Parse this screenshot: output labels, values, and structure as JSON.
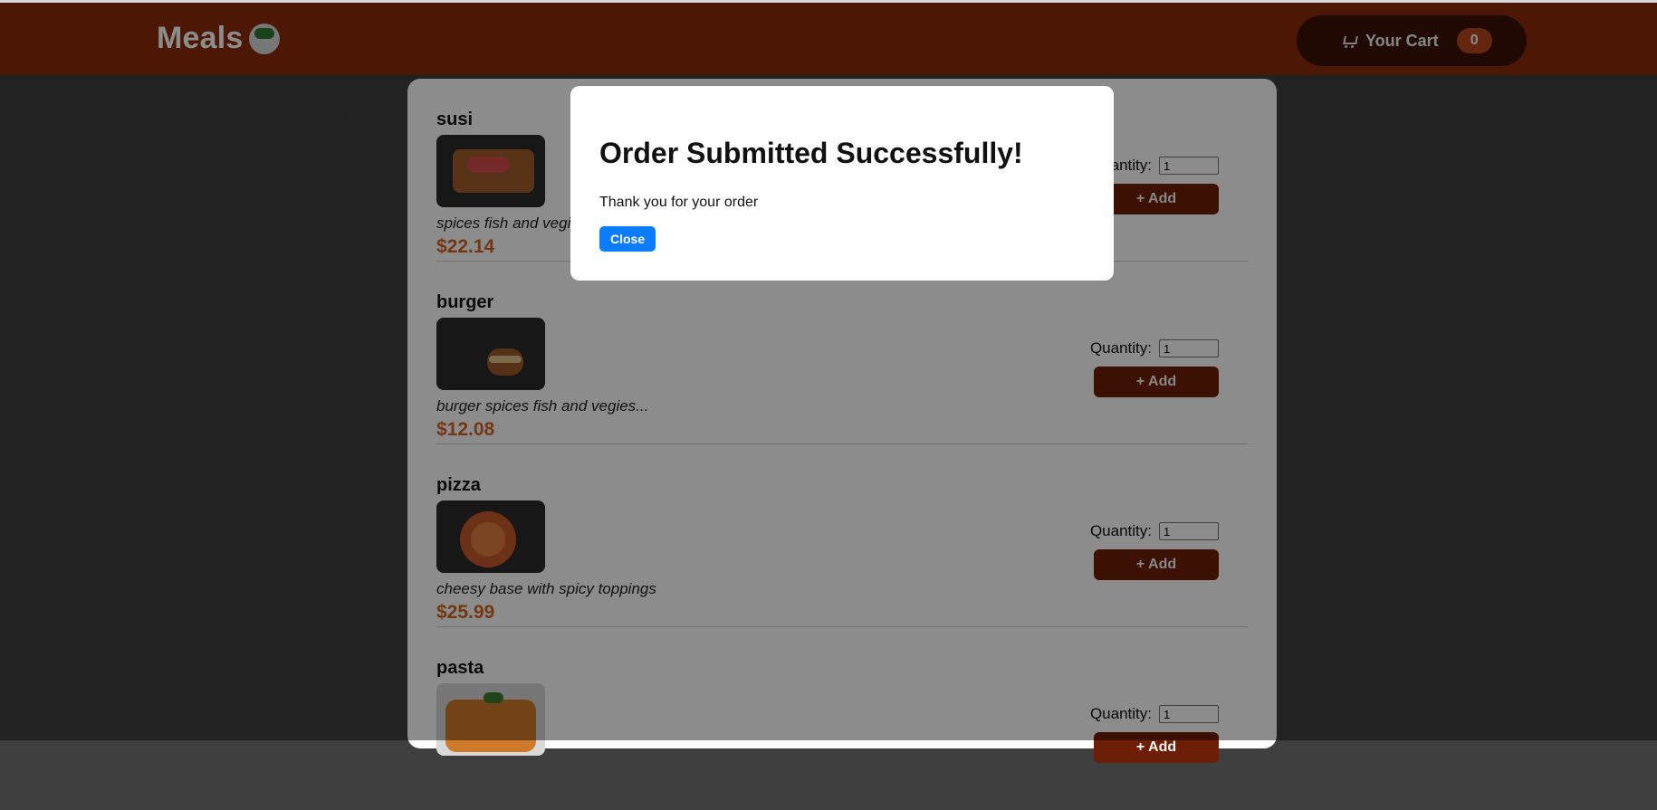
{
  "header": {
    "logo_text": "Meals",
    "cart_label": "Your Cart",
    "cart_count": "0"
  },
  "meals": [
    {
      "name": "susi",
      "desc": "spices fish and vegies...",
      "price": "$22.14",
      "qty_label": "Quantity:",
      "qty_value": "1",
      "add_label": "+ Add"
    },
    {
      "name": "burger",
      "desc": "burger spices fish and vegies...",
      "price": "$12.08",
      "qty_label": "Quantity:",
      "qty_value": "1",
      "add_label": "+ Add"
    },
    {
      "name": "pizza",
      "desc": "cheesy base with spicy toppings",
      "price": "$25.99",
      "qty_label": "Quantity:",
      "qty_value": "1",
      "add_label": "+ Add"
    },
    {
      "name": "pasta",
      "desc": "",
      "price": "",
      "qty_label": "Quantity:",
      "qty_value": "1",
      "add_label": "+ Add"
    }
  ],
  "modal": {
    "title": "Order Submitted Successfully!",
    "message": "Thank you for your order",
    "close_label": "Close"
  }
}
